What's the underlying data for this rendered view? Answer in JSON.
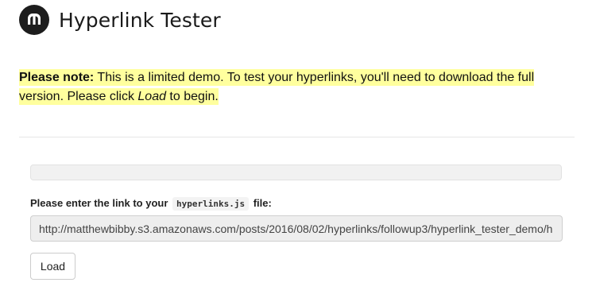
{
  "header": {
    "title": "Hyperlink Tester",
    "logo_icon": "m-logo-icon",
    "logo_color": "#1d1d1d"
  },
  "notice": {
    "bold_label": "Please note:",
    "text_part1": " This is a limited demo. To test your hyperlinks, you'll need to download the full version. Please click ",
    "italic_word": "Load",
    "text_part2": " to begin.",
    "highlight_color": "#ffff9e"
  },
  "progress": {
    "value": 0
  },
  "link_field": {
    "label_prefix": "Please enter the link to your ",
    "label_code": "hyperlinks.js",
    "label_suffix": " file:",
    "value": "http://matthewbibby.s3.amazonaws.com/posts/2016/08/02/hyperlinks/followup3/hyperlink_tester_demo/h"
  },
  "load_button": {
    "label": "Load"
  }
}
